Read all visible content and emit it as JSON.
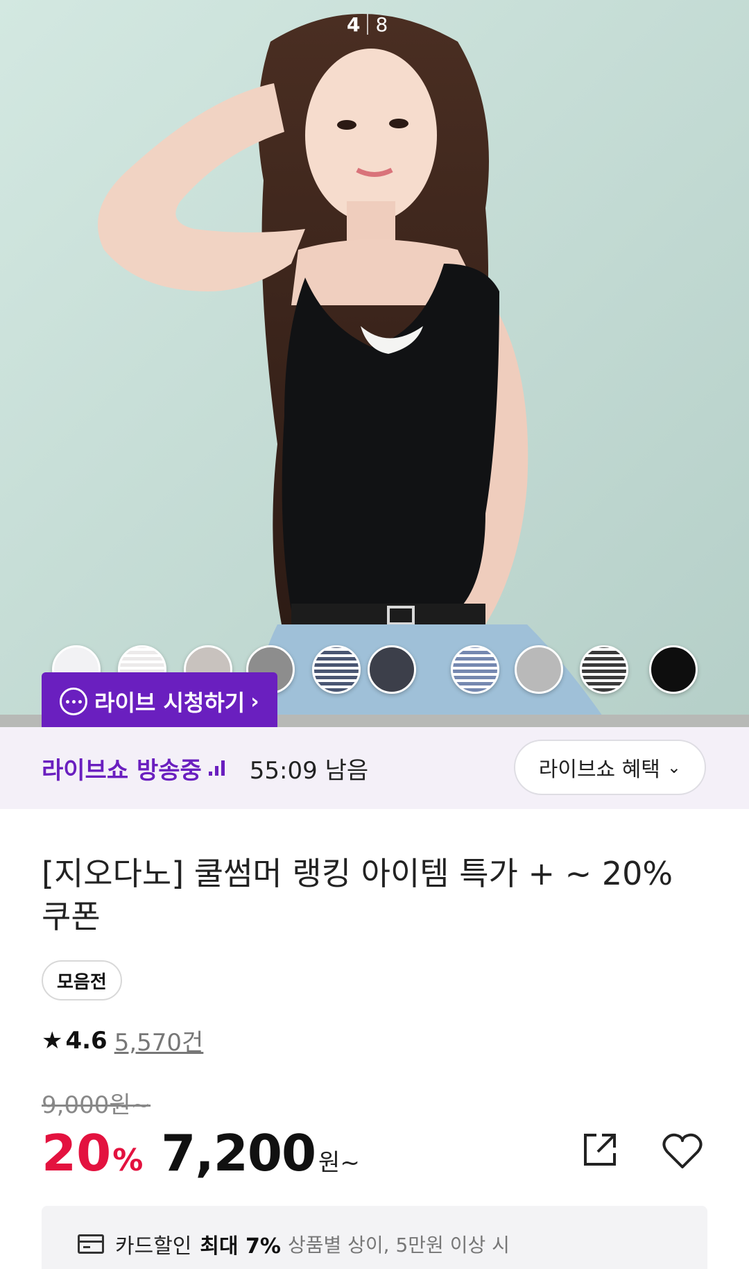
{
  "hero": {
    "image_alt": "모델 착용 이미지",
    "counter_current": "4",
    "counter_total": "8",
    "swatches": [
      {
        "name": "white",
        "color": "#f2f2f4"
      },
      {
        "name": "white-stripe",
        "color": "#eceaea"
      },
      {
        "name": "beige-gray",
        "color": "#c8c2be"
      },
      {
        "name": "gray",
        "color": "#8d8d8d"
      },
      {
        "name": "navy-stripe",
        "color": "#4a5672"
      },
      {
        "name": "charcoal",
        "color": "#3c3f4a"
      },
      {
        "name": "blue-stripe",
        "color": "#7588b0"
      },
      {
        "name": "light-gray",
        "color": "#b9b9b9"
      },
      {
        "name": "black-stripe",
        "color": "#3a3a3a"
      },
      {
        "name": "black",
        "color": "#0e0e0e"
      }
    ],
    "live_cta": "라이브 시청하기"
  },
  "live_bar": {
    "status": "라이브쇼 방송중",
    "time_left": "55:09 남음",
    "benefit_button": "라이브쇼 혜택"
  },
  "product": {
    "title": "[지오다노] 쿨썸머 랭킹 아이템 특가 + ~ 20% 쿠폰",
    "tag": "모음전",
    "rating_score": "4.6",
    "review_count": "5,570건",
    "original_price": "9,000원~",
    "discount_value": "20",
    "discount_unit": "%",
    "price": "7,200",
    "price_unit": "원~"
  },
  "card_discount": {
    "label": "카드할인",
    "max": "최대 7%",
    "note": "상품별 상이, 5만원 이상 시"
  },
  "colors": {
    "brand_purple": "#6a1fbf",
    "discount_red": "#e3123f"
  }
}
